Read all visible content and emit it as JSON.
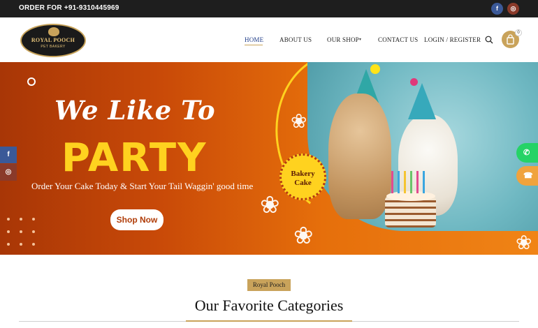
{
  "topbar": {
    "order_text": "ORDER FOR +91-9310445969",
    "facebook_glyph": "f",
    "instagram_glyph": "◎"
  },
  "logo": {
    "name": "ROYAL POOCH",
    "tagline": "PET BAKERY"
  },
  "nav": {
    "home": "HOME",
    "about": "ABOUT US",
    "shop": "OUR SHOP",
    "contact": "CONTACT US",
    "login": "LOGIN / REGISTER"
  },
  "cart": {
    "count": "0"
  },
  "hero": {
    "headline_script": "We Like To",
    "headline_big": "PARTY",
    "subtext": "Order Your Cake Today & Start Your Tail Waggin' good time",
    "cta": "Shop Now",
    "badge_line1": "Bakery",
    "badge_line2": "Cake"
  },
  "side_social": {
    "facebook_glyph": "f",
    "instagram_glyph": "◎"
  },
  "floating": {
    "whatsapp_glyph": "✆",
    "phone_glyph": "☎"
  },
  "section": {
    "tag": "Royal Pooch",
    "title": "Our Favorite Categories"
  },
  "colors": {
    "accent_gold": "#c9a35b",
    "hero_orange": "#e66f0b",
    "party_yellow": "#ffd21f",
    "topbar_dark": "#1e1e1e"
  }
}
